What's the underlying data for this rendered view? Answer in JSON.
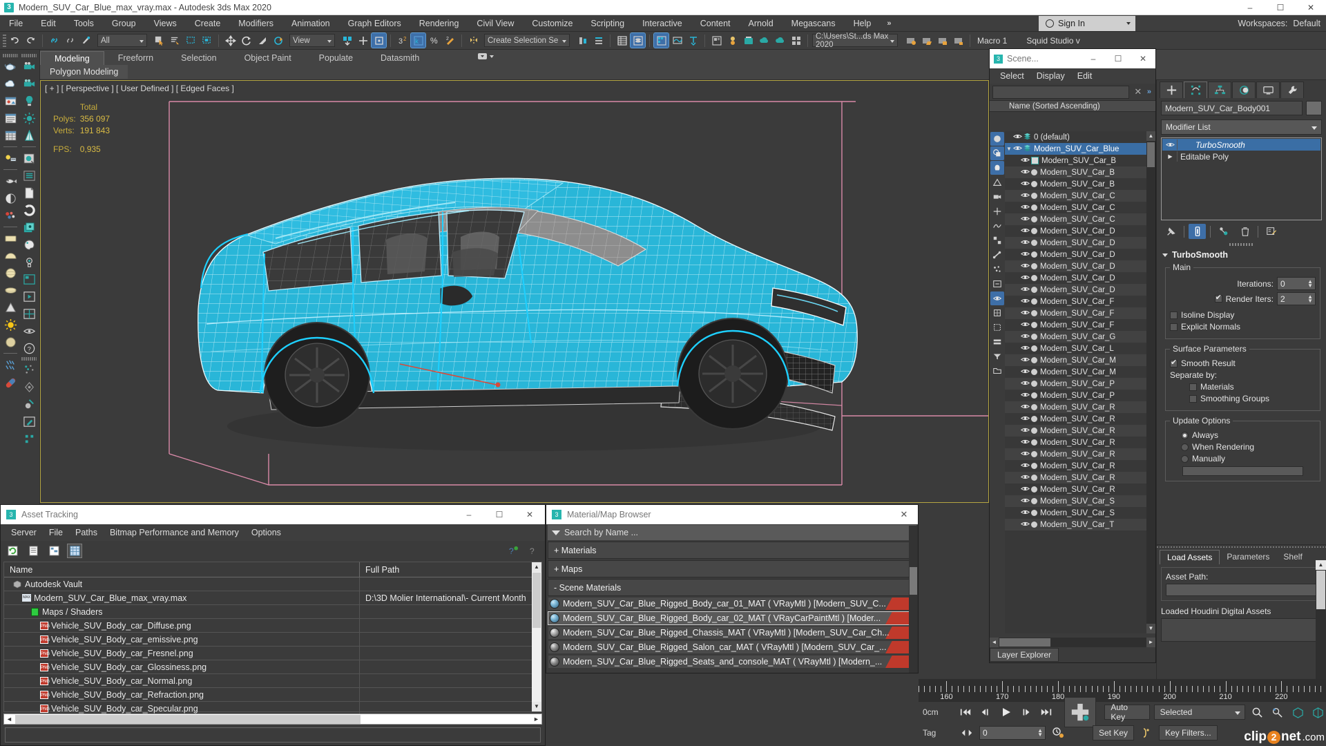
{
  "window": {
    "title": "Modern_SUV_Car_Blue_max_vray.max - Autodesk 3ds Max 2020",
    "app_badge": "3",
    "minimize": "–",
    "maximize": "☐",
    "close": "✕"
  },
  "menu": {
    "items": [
      "File",
      "Edit",
      "Tools",
      "Group",
      "Views",
      "Create",
      "Modifiers",
      "Animation",
      "Graph Editors",
      "Rendering",
      "Civil View",
      "Customize",
      "Scripting",
      "Interactive",
      "Content",
      "Arnold",
      "Megascans",
      "Help"
    ],
    "overflow": "»",
    "sign_in": "Sign In",
    "workspaces_label": "Workspaces:",
    "workspaces_value": "Default"
  },
  "toolbar": {
    "selection_filter": "All",
    "reference_coord": "View",
    "named_selection_set": "Create Selection Se",
    "project_path": "C:\\Users\\St...ds Max 2020",
    "macro_label": "Macro 1",
    "squid_label": "Squid Studio v"
  },
  "ribbon": {
    "tabs": [
      "Modeling",
      "Freeforrn",
      "Selection",
      "Object Paint",
      "Populate",
      "Datasmith"
    ],
    "active_tab": "Modeling",
    "subtab": "Polygon Modeling"
  },
  "viewport": {
    "label": "[ + ] [ Perspective ] [ User Defined ] [ Edged Faces ]",
    "stats_header": "Total",
    "polys_label": "Polys:",
    "polys_value": "356 097",
    "verts_label": "Verts:",
    "verts_value": "191 843",
    "fps_label": "FPS:",
    "fps_value": "0,935"
  },
  "scene_explorer": {
    "title": "Scene...",
    "app_badge": "3",
    "minimize": "–",
    "maximize": "☐",
    "close": "✕",
    "menu": [
      "Select",
      "Display",
      "Edit"
    ],
    "search_value": "",
    "search_clear": "✕",
    "chevron": "»",
    "column_header": "Name (Sorted Ascending)",
    "footer_tab": "Layer Explorer",
    "rows": [
      {
        "label": "0 (default)",
        "type": "layer",
        "indent": 1,
        "selected": false
      },
      {
        "label": "Modern_SUV_Car_Blue",
        "type": "layer",
        "indent": 1,
        "selected": true,
        "expanded": true
      },
      {
        "label": "Modern_SUV_Car_B",
        "type": "mesh",
        "indent": 2,
        "selected": false
      },
      {
        "label": "Modern_SUV_Car_B",
        "type": "obj",
        "indent": 2,
        "selected": false,
        "alt": true
      },
      {
        "label": "Modern_SUV_Car_B",
        "type": "obj",
        "indent": 2,
        "selected": false
      },
      {
        "label": "Modern_SUV_Car_C",
        "type": "obj",
        "indent": 2,
        "selected": false,
        "alt": true
      },
      {
        "label": "Modern_SUV_Car_C",
        "type": "obj",
        "indent": 2,
        "selected": false
      },
      {
        "label": "Modern_SUV_Car_C",
        "type": "obj",
        "indent": 2,
        "selected": false,
        "alt": true
      },
      {
        "label": "Modern_SUV_Car_D",
        "type": "obj",
        "indent": 2,
        "selected": false
      },
      {
        "label": "Modern_SUV_Car_D",
        "type": "obj",
        "indent": 2,
        "selected": false,
        "alt": true
      },
      {
        "label": "Modern_SUV_Car_D",
        "type": "obj",
        "indent": 2,
        "selected": false
      },
      {
        "label": "Modern_SUV_Car_D",
        "type": "obj",
        "indent": 2,
        "selected": false,
        "alt": true
      },
      {
        "label": "Modern_SUV_Car_D",
        "type": "obj",
        "indent": 2,
        "selected": false
      },
      {
        "label": "Modern_SUV_Car_D",
        "type": "obj",
        "indent": 2,
        "selected": false,
        "alt": true
      },
      {
        "label": "Modern_SUV_Car_F",
        "type": "obj",
        "indent": 2,
        "selected": false
      },
      {
        "label": "Modern_SUV_Car_F",
        "type": "obj",
        "indent": 2,
        "selected": false,
        "alt": true
      },
      {
        "label": "Modern_SUV_Car_F",
        "type": "obj",
        "indent": 2,
        "selected": false
      },
      {
        "label": "Modern_SUV_Car_G",
        "type": "obj",
        "indent": 2,
        "selected": false,
        "alt": true
      },
      {
        "label": "Modern_SUV_Car_L",
        "type": "obj",
        "indent": 2,
        "selected": false
      },
      {
        "label": "Modern_SUV_Car_M",
        "type": "obj",
        "indent": 2,
        "selected": false,
        "alt": true
      },
      {
        "label": "Modern_SUV_Car_M",
        "type": "obj",
        "indent": 2,
        "selected": false
      },
      {
        "label": "Modern_SUV_Car_P",
        "type": "obj",
        "indent": 2,
        "selected": false,
        "alt": true
      },
      {
        "label": "Modern_SUV_Car_P",
        "type": "obj",
        "indent": 2,
        "selected": false
      },
      {
        "label": "Modern_SUV_Car_R",
        "type": "obj",
        "indent": 2,
        "selected": false,
        "alt": true
      },
      {
        "label": "Modern_SUV_Car_R",
        "type": "obj",
        "indent": 2,
        "selected": false
      },
      {
        "label": "Modern_SUV_Car_R",
        "type": "obj",
        "indent": 2,
        "selected": false,
        "alt": true
      },
      {
        "label": "Modern_SUV_Car_R",
        "type": "obj",
        "indent": 2,
        "selected": false
      },
      {
        "label": "Modern_SUV_Car_R",
        "type": "obj",
        "indent": 2,
        "selected": false,
        "alt": true
      },
      {
        "label": "Modern_SUV_Car_R",
        "type": "obj",
        "indent": 2,
        "selected": false
      },
      {
        "label": "Modern_SUV_Car_R",
        "type": "obj",
        "indent": 2,
        "selected": false,
        "alt": true
      },
      {
        "label": "Modern_SUV_Car_R",
        "type": "obj",
        "indent": 2,
        "selected": false
      },
      {
        "label": "Modern_SUV_Car_S",
        "type": "obj",
        "indent": 2,
        "selected": false,
        "alt": true
      },
      {
        "label": "Modern_SUV_Car_S",
        "type": "obj",
        "indent": 2,
        "selected": false
      },
      {
        "label": "Modern_SUV_Car_T",
        "type": "obj",
        "indent": 2,
        "selected": false,
        "alt": true
      }
    ]
  },
  "command_panel": {
    "object_name": "Modern_SUV_Car_Body001",
    "modifier_list_label": "Modifier List",
    "stack": [
      {
        "label": "TurboSmooth",
        "selected": true,
        "italic": true,
        "eye": true
      },
      {
        "label": "Editable Poly",
        "selected": false,
        "italic": false,
        "eye": false
      }
    ],
    "rollout": {
      "title": "TurboSmooth",
      "main_group": "Main",
      "iterations_label": "Iterations:",
      "iterations_value": "0",
      "render_iters_label": "Render Iters:",
      "render_iters_value": "2",
      "render_iters_checked": true,
      "isoline_display_label": "Isoline Display",
      "isoline_display_checked": false,
      "explicit_normals_label": "Explicit Normals",
      "explicit_normals_checked": false,
      "surface_group": "Surface Parameters",
      "smooth_result_label": "Smooth Result",
      "smooth_result_checked": true,
      "separate_by_label": "Separate by:",
      "materials_label": "Materials",
      "materials_checked": false,
      "smoothing_groups_label": "Smoothing Groups",
      "smoothing_groups_checked": false,
      "update_group": "Update Options",
      "always_label": "Always",
      "when_rendering_label": "When Rendering",
      "manually_label": "Manually",
      "update_selected": "Always"
    }
  },
  "houdini_panel": {
    "tabs": [
      "Load Assets",
      "Parameters",
      "Shelf"
    ],
    "active_tab": "Load Assets",
    "asset_path_label": "Asset Path:",
    "asset_path_value": "",
    "loaded_label": "Loaded Houdini Digital Assets"
  },
  "asset_tracking": {
    "title": "Asset Tracking",
    "app_badge": "3",
    "minimize": "–",
    "maximize": "☐",
    "close": "✕",
    "menu": [
      "Server",
      "File",
      "Paths",
      "Bitmap Performance and Memory",
      "Options"
    ],
    "columns": [
      "Name",
      "Full Path"
    ],
    "rows": [
      {
        "name": "Autodesk Vault",
        "path": "",
        "icon": "vault-icon",
        "indent": 1
      },
      {
        "name": "Modern_SUV_Car_Blue_max_vray.max",
        "path": "D:\\3D Molier International\\- Current Month",
        "icon": "max-file-icon",
        "indent": 2
      },
      {
        "name": "Maps / Shaders",
        "path": "",
        "icon": "maps-icon",
        "indent": 3
      },
      {
        "name": "Vehicle_SUV_Body_car_Diffuse.png",
        "path": "",
        "icon": "png-icon",
        "indent": 4
      },
      {
        "name": "Vehicle_SUV_Body_car_emissive.png",
        "path": "",
        "icon": "png-icon",
        "indent": 4
      },
      {
        "name": "Vehicle_SUV_Body_car_Fresnel.png",
        "path": "",
        "icon": "png-icon",
        "indent": 4
      },
      {
        "name": "Vehicle_SUV_Body_car_Glossiness.png",
        "path": "",
        "icon": "png-icon",
        "indent": 4
      },
      {
        "name": "Vehicle_SUV_Body_car_Normal.png",
        "path": "",
        "icon": "png-icon",
        "indent": 4
      },
      {
        "name": "Vehicle_SUV_Body_car_Refraction.png",
        "path": "",
        "icon": "png-icon",
        "indent": 4
      },
      {
        "name": "Vehicle_SUV_Body_car_Specular.png",
        "path": "",
        "icon": "png-icon",
        "indent": 4
      }
    ]
  },
  "material_browser": {
    "title": "Material/Map Browser",
    "app_badge": "3",
    "close": "✕",
    "search_placeholder": "Search by Name ...",
    "groups": [
      {
        "label": "+ Materials",
        "expanded": false
      },
      {
        "label": "+ Maps",
        "expanded": false
      },
      {
        "label": "-  Scene Materials",
        "expanded": true
      }
    ],
    "materials": [
      {
        "label": "Modern_SUV_Car_Blue_Rigged_Body_car_01_MAT ( VRayMtl ) [Modern_SUV_C...",
        "selected": false,
        "swatch": "blue"
      },
      {
        "label": "Modern_SUV_Car_Blue_Rigged_Body_car_02_MAT ( VRayCarPaintMtl ) [Moder...",
        "selected": true,
        "swatch": "blue"
      },
      {
        "label": "Modern_SUV_Car_Blue_Rigged_Chassis_MAT ( VRayMtl ) [Modern_SUV_Car_Ch...",
        "selected": false,
        "swatch": "gray"
      },
      {
        "label": "Modern_SUV_Car_Blue_Rigged_Salon_car_MAT ( VRayMtl ) [Modern_SUV_Car_...",
        "selected": false,
        "swatch": "dark"
      },
      {
        "label": "Modern_SUV_Car_Blue_Rigged_Seats_and_console_MAT ( VRayMtl ) [Modern_...",
        "selected": false,
        "swatch": "dark"
      }
    ]
  },
  "timeline": {
    "ticks": [
      "160",
      "170",
      "180",
      "190",
      "200",
      "210",
      "220"
    ],
    "tick_values": [
      160,
      170,
      180,
      190,
      200,
      210,
      220
    ],
    "range_start": 155,
    "range_end": 228
  },
  "status": {
    "coord_value": "0cm",
    "tag_label": "Tag",
    "frame_value": "0",
    "auto_key": "Auto Key",
    "set_key": "Set Key",
    "key_mode": "Selected",
    "key_filters": "Key Filters...",
    "watermark": "clip2net.com"
  },
  "colors": {
    "accent_blue": "#29b6d8",
    "selection_blue": "#3a6ea5",
    "viewport_border": "#b5a642",
    "stat_yellow": "#c9ae3c",
    "pink_helper": "#d98aa8",
    "teal": "#27b5ae"
  }
}
